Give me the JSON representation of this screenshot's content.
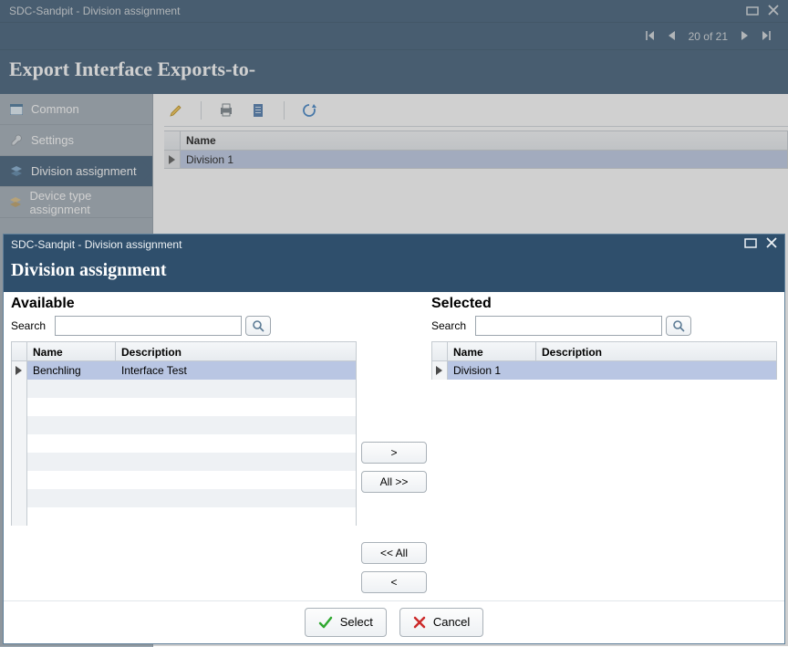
{
  "back": {
    "title": "SDC-Sandpit - Division assignment",
    "heading": "Export Interface Exports-to-",
    "nav_pos": "20 of 21",
    "sidebar": {
      "items": [
        {
          "label": "Common"
        },
        {
          "label": "Settings"
        },
        {
          "label": "Division assignment"
        },
        {
          "label": "Device type assignment"
        }
      ],
      "active_index": 2
    },
    "grid": {
      "header_name": "Name",
      "rows": [
        {
          "name": "Division 1"
        }
      ]
    }
  },
  "dialog": {
    "title": "SDC-Sandpit - Division assignment",
    "heading": "Division assignment",
    "available_title": "Available",
    "selected_title": "Selected",
    "search_label": "Search",
    "col_name": "Name",
    "col_desc": "Description",
    "available_rows": [
      {
        "name": "Benchling",
        "desc": "Interface Test"
      }
    ],
    "selected_rows": [
      {
        "name": "Division 1",
        "desc": ""
      }
    ],
    "xfer": {
      "right": ">",
      "all_right": "All >>",
      "all_left": "<< All",
      "left": "<"
    },
    "footer": {
      "select": "Select",
      "cancel": "Cancel"
    }
  }
}
